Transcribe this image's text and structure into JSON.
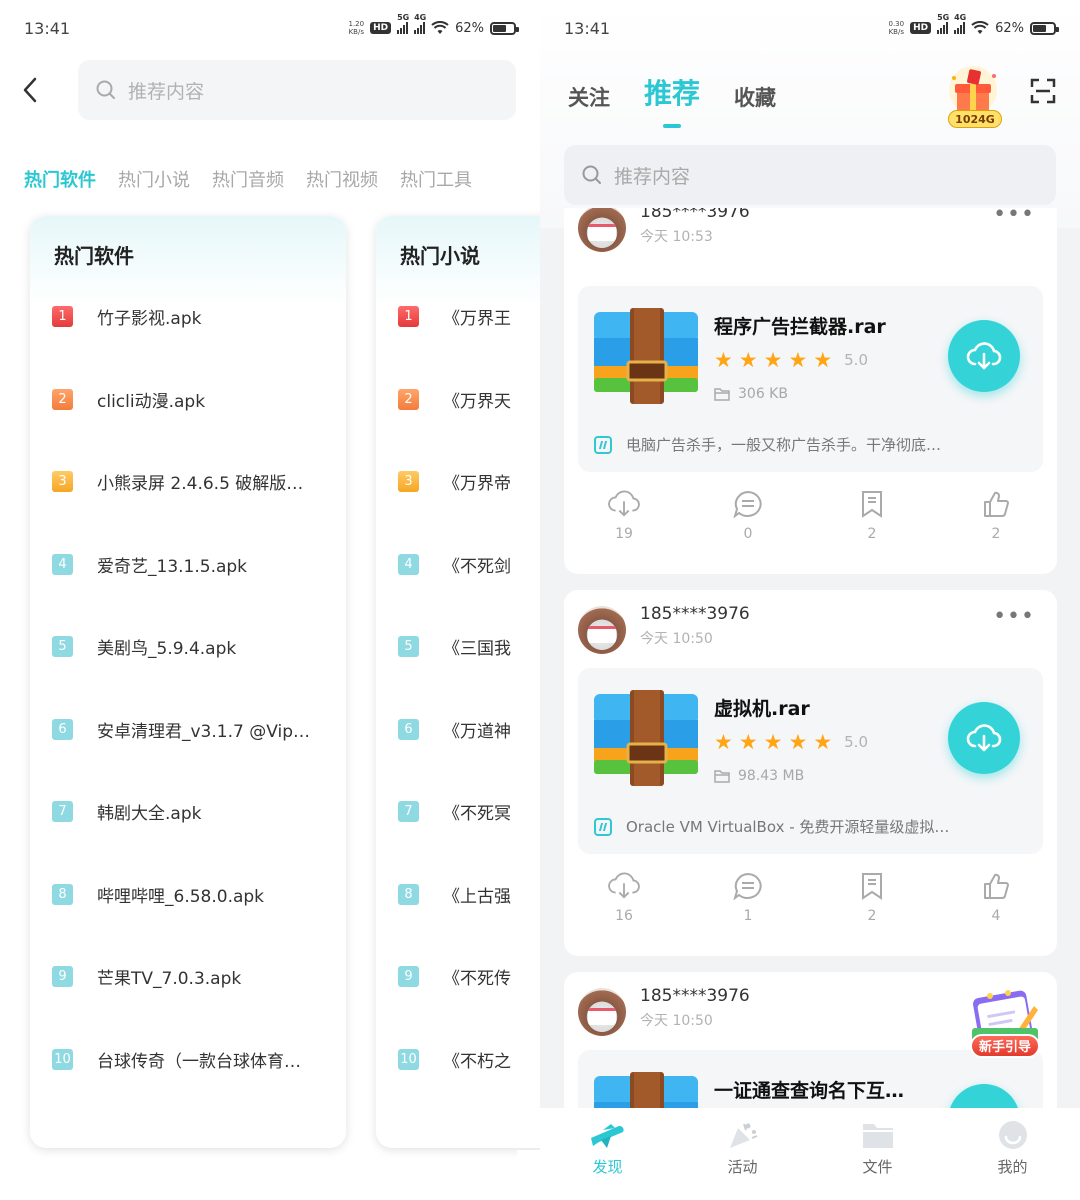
{
  "left": {
    "status": {
      "time": "13:41",
      "speed_value": "1.20",
      "speed_unit": "KB/s",
      "hd": "HD",
      "net1": "5G",
      "net2": "4G",
      "battery": "62%"
    },
    "search_placeholder": "推荐内容",
    "category_tabs": [
      "热门软件",
      "热门小说",
      "热门音频",
      "热门视频",
      "热门工具"
    ],
    "software_card": {
      "title": "热门软件",
      "items": [
        {
          "rank": "1",
          "name": "竹子影视.apk"
        },
        {
          "rank": "2",
          "name": "clicli动漫.apk"
        },
        {
          "rank": "3",
          "name": "小熊录屏 2.4.6.5 破解版…"
        },
        {
          "rank": "4",
          "name": "爱奇艺_13.1.5.apk"
        },
        {
          "rank": "5",
          "name": "美剧鸟_5.9.4.apk"
        },
        {
          "rank": "6",
          "name": "安卓清理君_v3.1.7 @Vip…"
        },
        {
          "rank": "7",
          "name": "韩剧大全.apk"
        },
        {
          "rank": "8",
          "name": "哔哩哔哩_6.58.0.apk"
        },
        {
          "rank": "9",
          "name": "芒果TV_7.0.3.apk"
        },
        {
          "rank": "10",
          "name": "台球传奇（一款台球体育…"
        }
      ]
    },
    "novel_card": {
      "title": "热门小说",
      "items": [
        {
          "rank": "1",
          "name": "《万界王"
        },
        {
          "rank": "2",
          "name": "《万界天"
        },
        {
          "rank": "3",
          "name": "《万界帝"
        },
        {
          "rank": "4",
          "name": "《不死剑"
        },
        {
          "rank": "5",
          "name": "《三国我"
        },
        {
          "rank": "6",
          "name": "《万道神"
        },
        {
          "rank": "7",
          "name": "《不死冥"
        },
        {
          "rank": "8",
          "name": "《上古强"
        },
        {
          "rank": "9",
          "name": "《不死传"
        },
        {
          "rank": "10",
          "name": "《不朽之"
        }
      ]
    }
  },
  "right": {
    "status": {
      "time": "13:41",
      "speed_value": "0.30",
      "speed_unit": "KB/s",
      "hd": "HD",
      "net1": "5G",
      "net2": "4G",
      "battery": "62%"
    },
    "tabs": [
      "关注",
      "推荐",
      "收藏"
    ],
    "gift_badge": "1024G",
    "search_placeholder": "推荐内容",
    "posts": [
      {
        "user": "185****3976",
        "time": "今天 10:53",
        "more": "•••",
        "file_name": "程序广告拦截器.rar",
        "rating": "5.0",
        "size": "306 KB",
        "desc": "电脑广告杀手，一般又称广告杀手。干净彻底…",
        "downloads": "19",
        "comments": "0",
        "favorites": "2",
        "likes": "2"
      },
      {
        "user": "185****3976",
        "time": "今天 10:50",
        "more": "•••",
        "file_name": "虚拟机.rar",
        "rating": "5.0",
        "size": "98.43 MB",
        "desc": "Oracle VM VirtualBox - 免费开源轻量级虚拟…",
        "downloads": "16",
        "comments": "1",
        "favorites": "2",
        "likes": "4"
      },
      {
        "user": "185****3976",
        "time": "今天 10:50",
        "file_name": "一证通查查询名下互…"
      }
    ],
    "guide_label": "新手引导",
    "nav": [
      "发现",
      "活动",
      "文件",
      "我的"
    ],
    "accent_color": "#2bc7d3",
    "star_color": "#ffa516"
  }
}
